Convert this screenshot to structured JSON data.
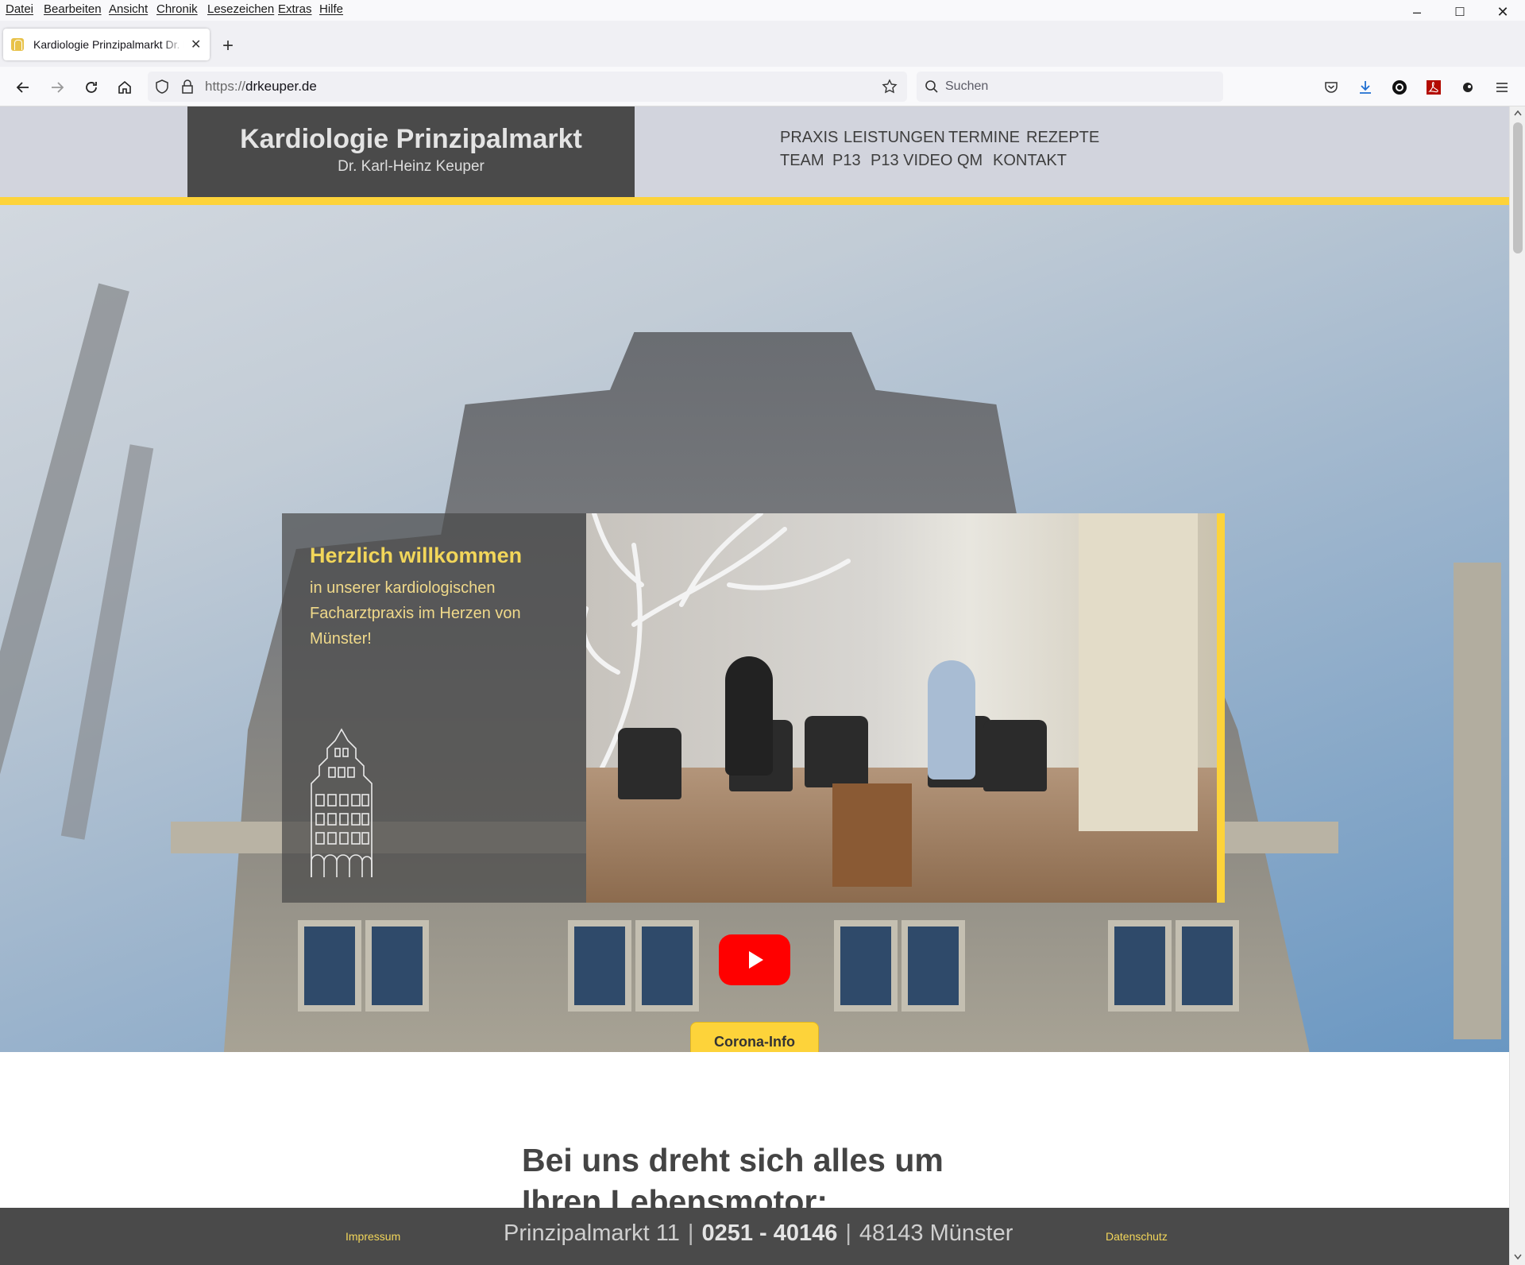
{
  "menubar": {
    "items": [
      "Datei",
      "Bearbeiten",
      "Ansicht",
      "Chronik",
      "Lesezeichen",
      "Extras",
      "Hilfe"
    ]
  },
  "window_controls": {
    "minimize": "–",
    "maximize": "☐",
    "close": "✕"
  },
  "tab": {
    "title": "Kardiologie Prinzipalmarkt Dr. K",
    "close": "✕",
    "new_tab": "+"
  },
  "navbar": {
    "url_scheme": "https://",
    "url_host": "drkeuper.de",
    "search_placeholder": "Suchen"
  },
  "site": {
    "logo_title": "Kardiologie Prinzipalmarkt",
    "logo_subtitle": "Dr. Karl-Heinz Keuper",
    "nav": [
      "PRAXIS",
      "LEISTUNGEN",
      "TERMINE",
      "REZEPTE",
      "TEAM",
      "P13",
      "P13 VIDEO",
      "QM",
      "KONTAKT"
    ],
    "welcome_title": "Herzlich willkommen",
    "welcome_text": "in unserer kardiologischen Facharztpraxis im Herzen von Münster!",
    "corona_button": "Corona-Info",
    "heading": "Bei uns dreht sich alles um Ihren Lebensmotor:",
    "footer": {
      "impressum": "Impressum",
      "street": "Prinzipalmarkt 11",
      "phone": "0251 - 40146",
      "city": "48143 Münster",
      "datenschutz": "Datenschutz",
      "separator": "|"
    }
  },
  "colors": {
    "accent_yellow": "#fdd33a",
    "logo_bg": "#4a4a4a",
    "header_bg": "#d2d4dd",
    "youtube_red": "#ff0000"
  }
}
